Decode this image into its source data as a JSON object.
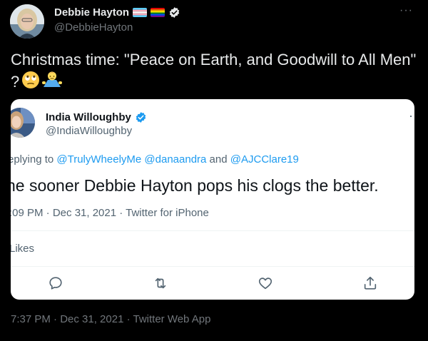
{
  "author": {
    "display_name": "Debbie Hayton",
    "handle": "@DebbieHayton",
    "verified": true
  },
  "tweet": {
    "text": "Christmas time: \"Peace on Earth, and Goodwill to All Men\" ?",
    "emojis": [
      "face-with-rolling-eyes",
      "man-shrugging"
    ],
    "timestamp": "7:37 PM · Dec 31, 2021 · Twitter Web App"
  },
  "quoted_tweet": {
    "display_name": "India Willoughby",
    "handle": "@IndiaWilloughby",
    "verified": true,
    "reply_prefix": "eplying to ",
    "mentions": [
      "@TrulyWheelyMe",
      "@danaandra",
      "@AJCClare19"
    ],
    "reply_joiner_space": " ",
    "reply_joiner_and": " and ",
    "text": "he sooner Debbie Hayton pops his clogs the better.",
    "timestamp": ":09 PM · Dec 31, 2021 · Twitter for iPhone",
    "likes_label": "Likes",
    "actions": [
      "reply-icon",
      "retweet-icon",
      "like-icon",
      "share-icon"
    ]
  },
  "colors": {
    "background": "#000000",
    "link": "#1d9bf0",
    "verified": "#1d9bf0"
  }
}
